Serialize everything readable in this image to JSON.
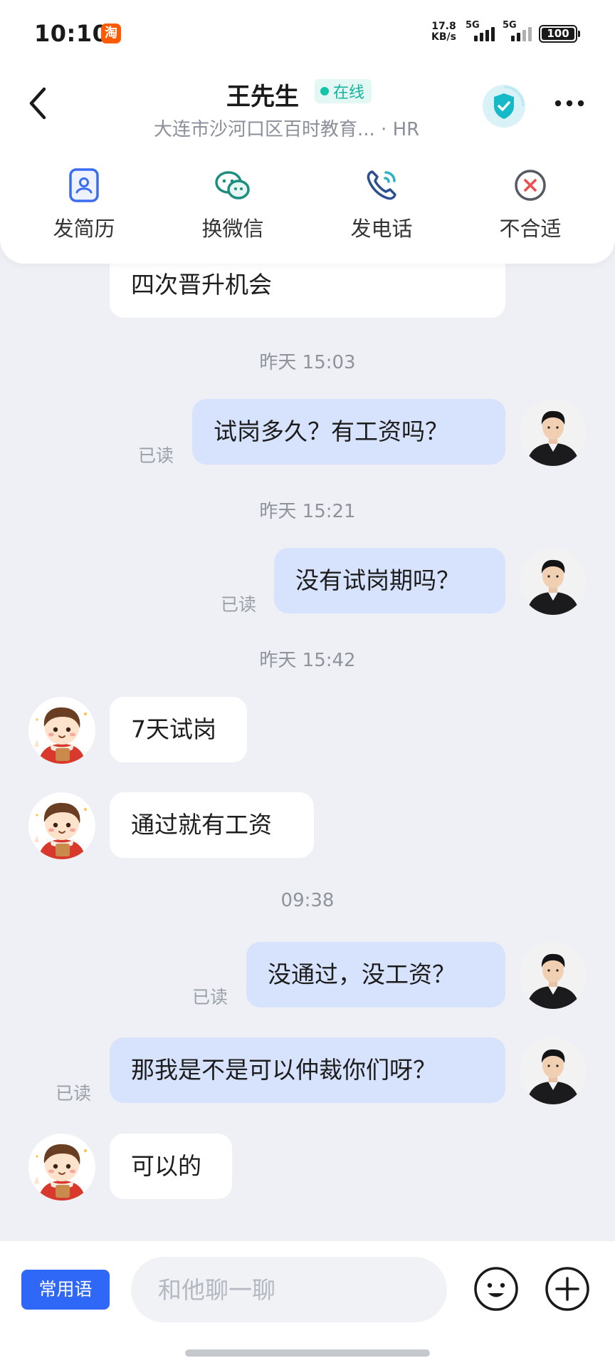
{
  "status_bar": {
    "time": "10:10",
    "app_icon_label": "淘",
    "net_speed_value": "17.8",
    "net_speed_unit": "KB/s",
    "sim1_network": "5G",
    "sim2_network": "5G",
    "battery": "100"
  },
  "header": {
    "contact_name": "王先生",
    "online_status": "在线",
    "subtitle": "大连市沙河口区百时教育... · HR",
    "accent_color": "#14c4a7"
  },
  "actions": [
    {
      "label": "发简历",
      "icon": "resume-icon"
    },
    {
      "label": "换微信",
      "icon": "wechat-icon"
    },
    {
      "label": "发电话",
      "icon": "phone-icon"
    },
    {
      "label": "不合适",
      "icon": "close-circle-icon"
    }
  ],
  "chat": {
    "partial_message": "四次晋升机会",
    "timestamps": [
      "昨天 15:03",
      "昨天 15:21",
      "昨天 15:42",
      "09:38"
    ],
    "read_label": "已读",
    "messages": [
      {
        "side": "right",
        "text": "试岗多久？有工资吗？"
      },
      {
        "side": "right",
        "text": "没有试岗期吗？"
      },
      {
        "side": "left",
        "text": "7天试岗"
      },
      {
        "side": "left",
        "text": "通过就有工资"
      },
      {
        "side": "right",
        "text": "没通过，没工资？"
      },
      {
        "side": "right",
        "text": "那我是不是可以仲裁你们呀？"
      },
      {
        "side": "left",
        "text": "可以的"
      }
    ]
  },
  "composer": {
    "phrases_label": "常用语",
    "placeholder": "和他聊一聊",
    "value": ""
  }
}
